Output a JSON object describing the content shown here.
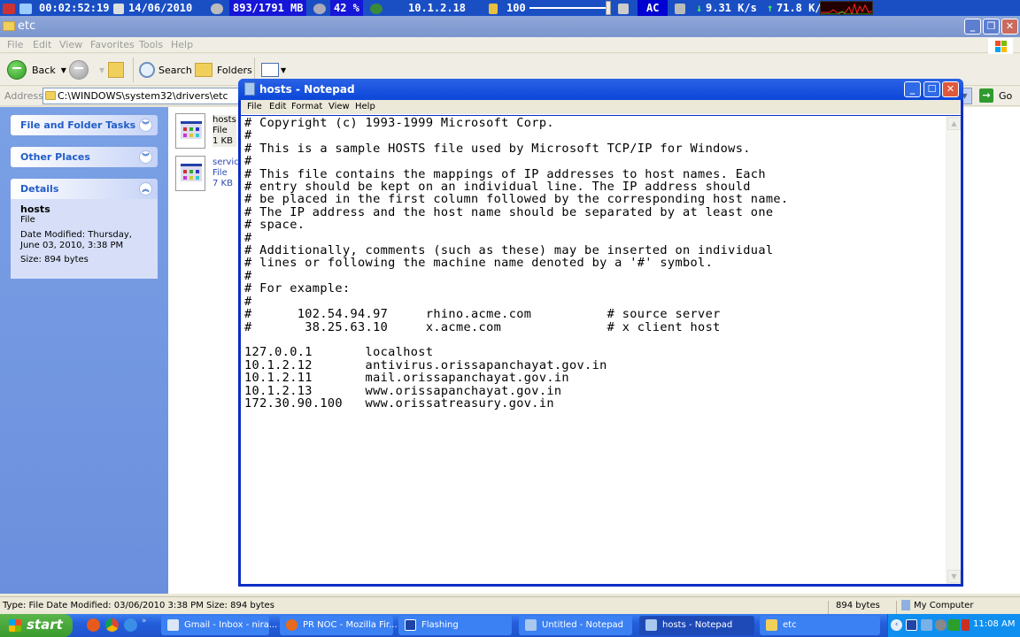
{
  "topbar": {
    "uptime": "00:02:52:19",
    "date": "14/06/2010",
    "memory": "893/1791 MB",
    "cpu": "42 %",
    "ip": "10.1.2.18",
    "volume": "100",
    "volume_level": 1.0,
    "power": "AC",
    "download": "9.31 K/s",
    "upload": "71.8 K/s"
  },
  "explorer": {
    "title": "etc",
    "menu": [
      "File",
      "Edit",
      "View",
      "Favorites",
      "Tools",
      "Help"
    ],
    "toolbar": {
      "back": "Back",
      "search": "Search",
      "folders": "Folders"
    },
    "address_label": "Address",
    "address": "C:\\WINDOWS\\system32\\drivers\\etc",
    "go": "Go",
    "panels": {
      "tasks": "File and Folder Tasks",
      "places": "Other Places",
      "details": "Details"
    },
    "details": {
      "name": "hosts",
      "type": "File",
      "modified": "Date Modified: Thursday, June 03, 2010, 3:38 PM",
      "size": "Size: 894 bytes"
    },
    "files": [
      {
        "name": "hosts",
        "type": "File",
        "size": "1 KB"
      },
      {
        "name": "services",
        "type": "File",
        "size": "7 KB"
      }
    ],
    "status": {
      "info": "Type: File Date Modified: 03/06/2010 3:38 PM Size: 894 bytes",
      "size": "894 bytes",
      "zone": "My Computer"
    }
  },
  "notepad": {
    "title": "hosts - Notepad",
    "menu": [
      "File",
      "Edit",
      "Format",
      "View",
      "Help"
    ],
    "content": "# Copyright (c) 1993-1999 Microsoft Corp.\n#\n# This is a sample HOSTS file used by Microsoft TCP/IP for Windows.\n#\n# This file contains the mappings of IP addresses to host names. Each\n# entry should be kept on an individual line. The IP address should\n# be placed in the first column followed by the corresponding host name.\n# The IP address and the host name should be separated by at least one\n# space.\n#\n# Additionally, comments (such as these) may be inserted on individual\n# lines or following the machine name denoted by a '#' symbol.\n#\n# For example:\n#\n#      102.54.94.97     rhino.acme.com          # source server\n#       38.25.63.10     x.acme.com              # x client host\n\n127.0.0.1       localhost\n10.1.2.12       antivirus.orissapanchayat.gov.in\n10.1.2.11       mail.orissapanchayat.gov.in\n10.1.2.13       www.orissapanchayat.gov.in\n172.30.90.100   www.orissatreasury.gov.in"
  },
  "taskbar": {
    "start": "start",
    "tasks": [
      {
        "label": "Gmail - Inbox - nira...",
        "active": false
      },
      {
        "label": "PR NOC - Mozilla Fir...",
        "active": false
      },
      {
        "label": "Flashing",
        "active": false
      },
      {
        "label": "Untitled - Notepad",
        "active": false
      },
      {
        "label": "hosts - Notepad",
        "active": true
      },
      {
        "label": "etc",
        "active": false
      }
    ],
    "clock": "11:08 AM"
  }
}
